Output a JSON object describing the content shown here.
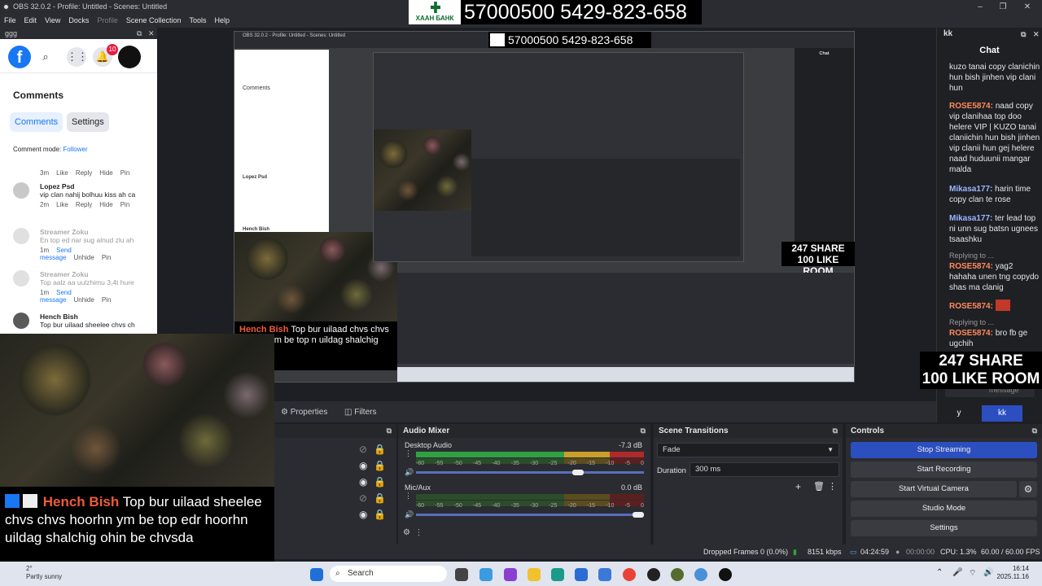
{
  "window": {
    "title": "OBS 32.0.2 - Profile: Untitled - Scenes: Untitled"
  },
  "menu": [
    "File",
    "Edit",
    "View",
    "Docks",
    "Profile",
    "Scene Collection",
    "Tools",
    "Help"
  ],
  "bank": {
    "logo_text": "ХААН БАНК",
    "number": "57000500 5429-823-658"
  },
  "fb_dock": {
    "dock_title": "ggg",
    "notif_count": "10",
    "heading": "Comments",
    "tabs": [
      "Comments",
      "Settings"
    ],
    "comment_mode_label": "Comment mode:",
    "comment_mode_value": "Follower",
    "first_actions": [
      "3m",
      "Like",
      "Reply",
      "Hide",
      "Pin"
    ],
    "comments": [
      {
        "name": "Lopez Psd",
        "text": "vip clan nahij bolhuu kiss ah ca",
        "actions": [
          "2m",
          "Like",
          "Reply",
          "Hide",
          "Pin"
        ],
        "faded": false
      },
      {
        "name": "Streamer Zoku",
        "text": "En top ed nar sug alnud zlu ah",
        "actions": [
          "1m",
          "Send message",
          "Unhide",
          "Pin"
        ],
        "faded": true
      },
      {
        "name": "Streamer Zoku",
        "text": "Top aalz aa uulzhimu 3,4t hure",
        "actions": [
          "1m",
          "Send message",
          "Unhide",
          "Pin"
        ],
        "faded": true
      },
      {
        "name": "Hench Bish",
        "text": "Top bur uilaad sheelee chvs ch",
        "actions": [],
        "faded": false
      }
    ]
  },
  "overlay": {
    "hench_name": "Hench Bish",
    "hench_text": "Top bur uilaad sheelee chvs chvs hoorhn ym be top edr hoorhn uildag shalchig ohin be chvsda",
    "preview_hench_text": "Top bur uilaad chvs chvs hoorhn ym be top n uildag shalchig ohin be",
    "share_line1": "247 SHARE",
    "share_line2": "100 LIKE ROOM"
  },
  "chat_dock": {
    "dock_title": "kk",
    "title": "Chat",
    "messages": [
      {
        "user": "",
        "text": "kuzo tanai copy clanichin hun bish jinhen vip clani hun"
      },
      {
        "user": "ROSE5874:",
        "text": "naad copy vip clanihaa top doo helere VIP | KUZO tanai claniichin hun bish jinhen vip clanii hun gej helere naad huduunii mangar malda"
      },
      {
        "user": "Mikasa177:",
        "text": "harin time copy clan te rose"
      },
      {
        "user": "Mikasa177:",
        "text": "ter lead top ni unn sug batsn ugnees tsaashku"
      },
      {
        "user": "ROSE5874:",
        "text": "yag2 hahaha unen tng copydo shas ma clanig",
        "reply": "Replying to ..."
      },
      {
        "user": "ROSE5874:",
        "text": ""
      },
      {
        "user": "ROSE5874:",
        "text": "bro fb ge ugchih",
        "reply": "Replying to ..."
      }
    ],
    "input_placeholder": "message",
    "buttons": [
      "y",
      "kk"
    ]
  },
  "obs": {
    "properties_label": "Properties",
    "filters_label": "Filters",
    "audio_mixer": {
      "title": "Audio Mixer",
      "channels": [
        {
          "name": "Desktop Audio",
          "level": "-7.3 dB",
          "volume": 0.72
        },
        {
          "name": "Mic/Aux",
          "level": "0.0 dB",
          "volume": 1.0
        }
      ],
      "ticks": [
        "-60",
        "-55",
        "-50",
        "-45",
        "-40",
        "-35",
        "-30",
        "-25",
        "-20",
        "-15",
        "-10",
        "-5",
        "0"
      ]
    },
    "transitions": {
      "title": "Scene Transitions",
      "type": "Fade",
      "duration_label": "Duration",
      "duration": "300 ms"
    },
    "controls": {
      "title": "Controls",
      "buttons": [
        "Stop Streaming",
        "Start Recording",
        "Start Virtual Camera",
        "Studio Mode",
        "Settings"
      ]
    },
    "status": {
      "dropped": "Dropped Frames 0 (0.0%)",
      "kbps": "8151 kbps",
      "stream_time": "04:24:59",
      "rec_time": "00:00:00",
      "cpu": "CPU: 1.3%",
      "fps": "60.00 / 60.00 FPS"
    }
  },
  "taskbar": {
    "search": "Search",
    "weather_temp": "2°",
    "weather": "Partly sunny",
    "time": "16:14",
    "date": "2025.11.16"
  }
}
